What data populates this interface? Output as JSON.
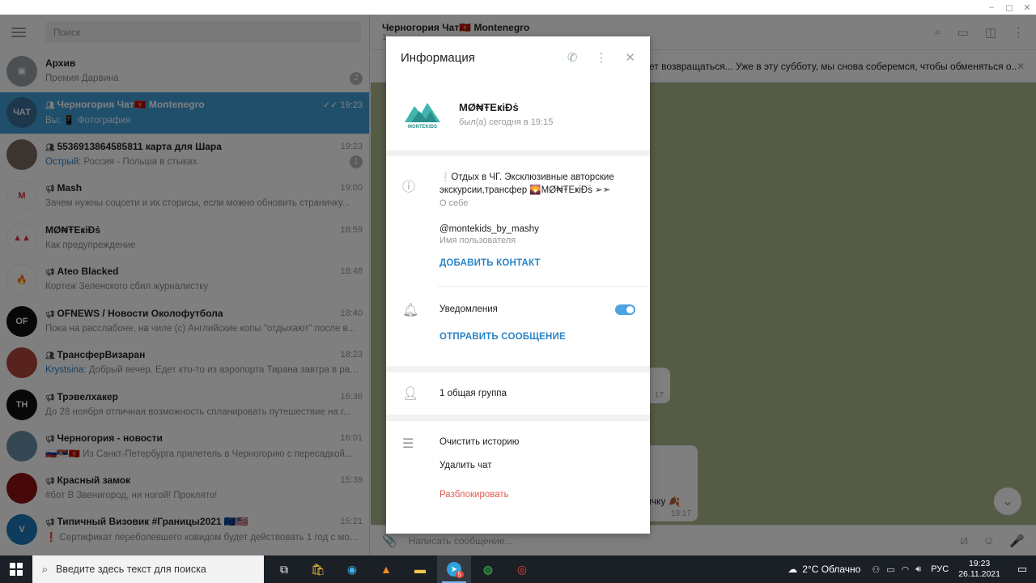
{
  "window": {
    "minimize": "–",
    "maximize": "◻",
    "close": "✕"
  },
  "left": {
    "search_placeholder": "Поиск",
    "chats": [
      {
        "name": "Архив",
        "time": "",
        "preview": "Премия Дарвина",
        "sender": "",
        "badge": "2",
        "avatar_color": "#9aa0a6",
        "avatar_text": "▣"
      },
      {
        "name": "Черногория Чат🇲🇪 Montenegro",
        "time": "19:23",
        "preview": "📱 Фотография",
        "sender": "Вы: ",
        "badge": "",
        "avatar_color": "#3a6f9a",
        "avatar_text": "ЧАТ",
        "group": true,
        "read": "✓✓"
      },
      {
        "name": "5536913864585811 карта для Шара",
        "time": "19:23",
        "preview": "Россия - Польша в стыках",
        "sender": "Острый: ",
        "badge": "1",
        "avatar_color": "#7a6a62",
        "avatar_text": "",
        "group": true
      },
      {
        "name": "Mash",
        "time": "19:00",
        "preview": "Зачем нужны соцсети и их сторисы, если можно обновить страничку...",
        "sender": "",
        "badge": "",
        "avatar_color": "#ffffff",
        "avatar_text": "M",
        "channel": true
      },
      {
        "name": "MØ₦ŦEҝiĐṡ",
        "time": "18:59",
        "preview": "Как предупреждение",
        "sender": "",
        "badge": "",
        "avatar_color": "#ffffff",
        "avatar_text": "▲▲"
      },
      {
        "name": "Ateo Blacked",
        "time": "18:48",
        "preview": "Кортеж Зеленского сбил журналистку",
        "sender": "",
        "badge": "",
        "avatar_color": "#ffffff",
        "avatar_text": "🔥",
        "channel": true
      },
      {
        "name": "OFNEWS / Новости Околофутбола",
        "time": "18:40",
        "preview": "Пока на расслабоне, на чиле (с)  Английские копы \"отдыхают\" после в...",
        "sender": "",
        "badge": "",
        "avatar_color": "#111111",
        "avatar_text": "OF",
        "channel": true
      },
      {
        "name": "ТрансферВизаран",
        "time": "18:23",
        "preview": "Добрый вечер. Едет кто-то из аэропорта Тирана завтра в район...",
        "sender": "Krystsina: ",
        "badge": "",
        "avatar_color": "#b0453a",
        "avatar_text": "",
        "group": true
      },
      {
        "name": "Трэвелхакер",
        "time": "16:36",
        "preview": "До 28 ноября отличная возможность спланировать путешествие на г...",
        "sender": "",
        "badge": "",
        "avatar_color": "#111111",
        "avatar_text": "TH",
        "channel": true
      },
      {
        "name": "Черногория - новости",
        "time": "16:01",
        "preview": "🇷🇺🇷🇸🇲🇪 Из Санкт-Петербурга прилетель в Черногорию с пересадкой...",
        "sender": "",
        "badge": "",
        "avatar_color": "#6d8ea8",
        "avatar_text": "",
        "channel": true
      },
      {
        "name": "Красный замок",
        "time": "15:39",
        "preview": "#бот  В Звенигород, ни ногой! Проклято!",
        "sender": "",
        "badge": "",
        "avatar_color": "#8c1010",
        "avatar_text": "",
        "channel": true
      },
      {
        "name": "Типичный Визовик #Границы2021 🇪🇺🇺🇸",
        "time": "15:21",
        "preview": "❗ Сертификат переболевшего ковидом будет действовать 1 год с момен...",
        "sender": "",
        "badge": "",
        "avatar_color": "#1d79b8",
        "avatar_text": "V",
        "channel": true
      }
    ]
  },
  "right": {
    "title": "Черногория Чат🇲🇪 Montenegro",
    "subtitle": "1",
    "pinned_text": "ет возвращаться... Уже в эту субботу, мы снова соберемся, чтобы обменяться о...",
    "bubble1_time": "17",
    "bubble2_text": "ичку 🍂",
    "bubble2_time": "19:17",
    "composer_placeholder": "Написать сообщение..."
  },
  "modal": {
    "title": "Информация",
    "name": "MØ₦ŦEҝiĐṡ",
    "status": "был(а) сегодня в 19:15",
    "logo_text": "MONTEKIDS",
    "bio": "❕Отдых в ЧГ. Эксклюзивные авторские экскурсии,трансфер 🌄MØ₦ŦEҝiĐṡ ➢➣",
    "bio_label": "О себе",
    "username": "@montekids_by_mashy",
    "username_label": "Имя пользователя",
    "add_contact": "ДОБАВИТЬ КОНТАКТ",
    "notifications": "Уведомления",
    "send_message": "ОТПРАВИТЬ СООБЩЕНИЕ",
    "groups": "1 общая группа",
    "clear_history": "Очистить историю",
    "delete_chat": "Удалить чат",
    "unblock": "Разблокировать"
  },
  "taskbar": {
    "search_placeholder": "Введите здесь текст для поиска",
    "weather": "2°C  Облачно",
    "lang": "РУС",
    "time": "19:23",
    "date": "26.11.2021",
    "telegram_badge": "5"
  },
  "colors": {
    "accent": "#419fd9",
    "danger": "#e3594d",
    "link": "#2b84c5"
  }
}
